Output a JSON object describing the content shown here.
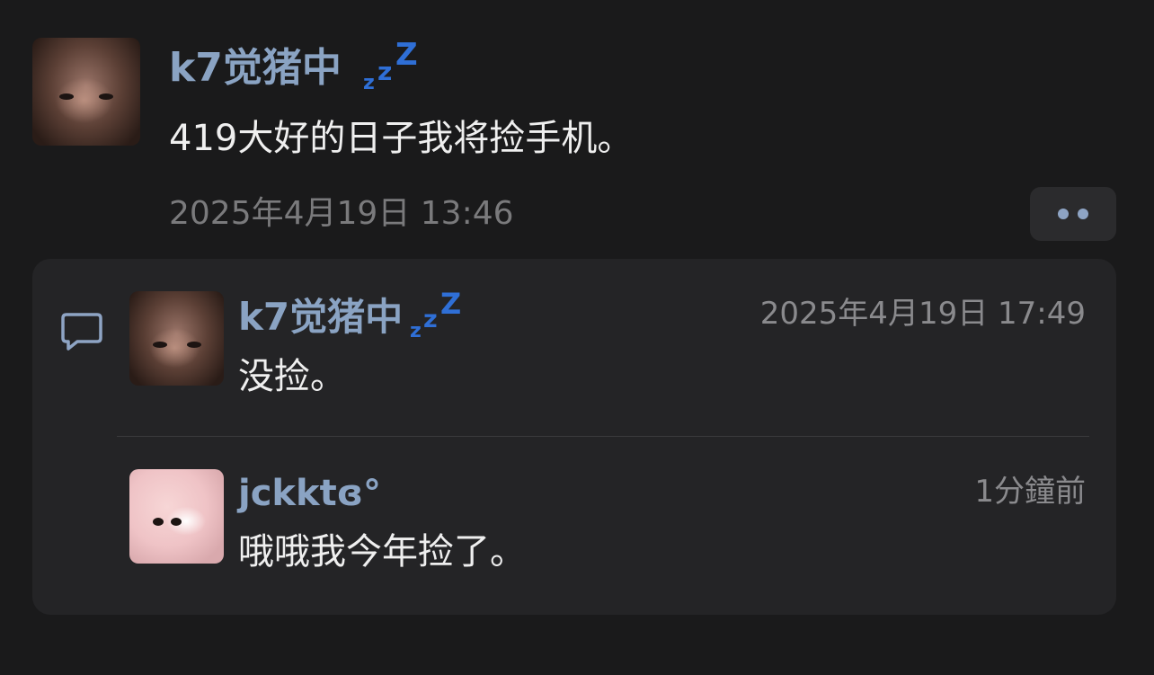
{
  "post": {
    "author": "k7觉猪中",
    "author_badge": "zZZ",
    "body": "419大好的日子我将捡手机。",
    "timestamp": "2025年4月19日 13:46",
    "more_icon": "more-dots-icon"
  },
  "replies": [
    {
      "author": "k7觉猪中",
      "author_badge": "zZZ",
      "body": "没捡。",
      "timestamp": "2025年4月19日 17:49"
    },
    {
      "author": "jckktɞ°",
      "body": "哦哦我今年捡了。",
      "timestamp": "1分鐘前"
    }
  ],
  "reply_icon": "comment-bubble-icon",
  "colors": {
    "background": "#1a1a1b",
    "card": "#242426",
    "name": "#8aa3c3",
    "badge": "#2f6fd6",
    "meta": "#7a7a7c"
  }
}
